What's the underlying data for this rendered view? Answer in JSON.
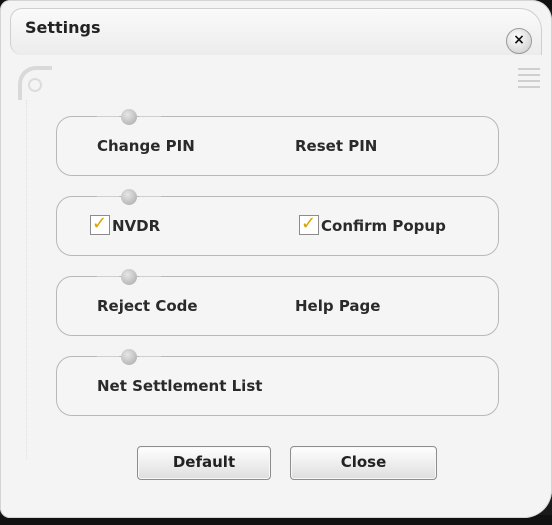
{
  "window": {
    "title": "Settings",
    "close_glyph": "×"
  },
  "groups": [
    {
      "items": [
        {
          "label": "Change PIN"
        },
        {
          "label": "Reset PIN"
        }
      ]
    },
    {
      "items": [
        {
          "label": "NVDR",
          "checked": true
        },
        {
          "label": "Confirm Popup",
          "checked": true
        }
      ]
    },
    {
      "items": [
        {
          "label": "Reject Code"
        },
        {
          "label": "Help Page"
        }
      ]
    },
    {
      "items": [
        {
          "label": "Net Settlement List"
        }
      ]
    }
  ],
  "buttons": {
    "default_label": "Default",
    "close_label": "Close"
  },
  "colors": {
    "checkmark": "#d9a200",
    "background": "#f4f4f4"
  }
}
